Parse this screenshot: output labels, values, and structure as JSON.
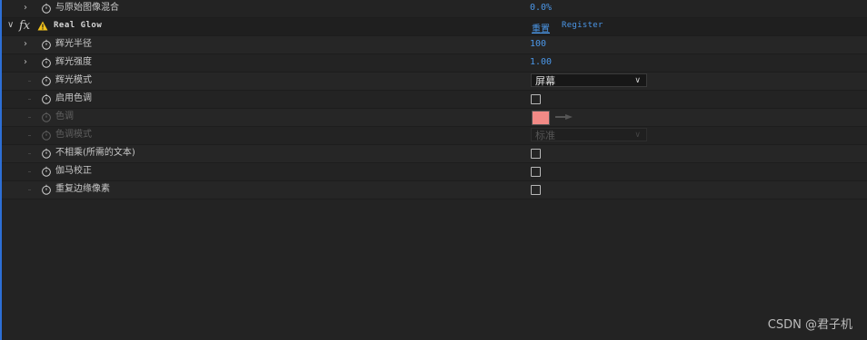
{
  "rows": {
    "blend_original": {
      "label": "与原始图像混合",
      "value": "0.0%"
    },
    "effect": {
      "fx": "fx",
      "name": "Real Glow",
      "reset": "重置",
      "register": "Register",
      "warning_icon": "warning-triangle-icon"
    },
    "glow_radius": {
      "label": "辉光半径",
      "value": "100"
    },
    "glow_intensity": {
      "label": "辉光强度",
      "value": "1.00"
    },
    "glow_mode": {
      "label": "辉光模式",
      "selected": "屏幕"
    },
    "enable_tint": {
      "label": "启用色调",
      "checked": false
    },
    "tint": {
      "label": "色调",
      "color": "#f28a86"
    },
    "tint_mode": {
      "label": "色调模式",
      "selected": "标准"
    },
    "unmultiply": {
      "label": "不相乘(所需的文本)",
      "checked": false
    },
    "gamma": {
      "label": "伽马校正",
      "checked": false
    },
    "repeat_edge": {
      "label": "重复边缘像素",
      "checked": false
    }
  },
  "watermark": "CSDN @君子机",
  "colors": {
    "link": "#4b97e8",
    "background": "#232323",
    "accent": "#2d6fd6"
  }
}
